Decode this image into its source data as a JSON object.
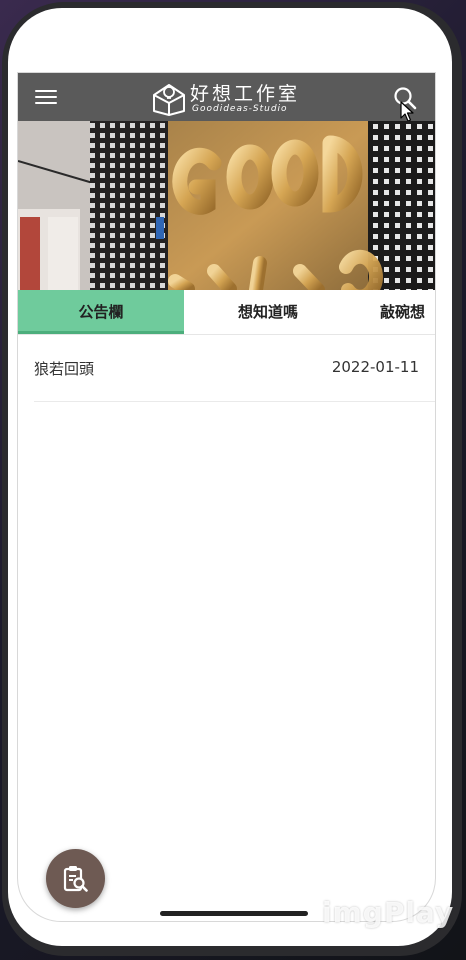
{
  "header": {
    "brand_name": "好想工作室",
    "brand_subtitle": "Goodideas-Studio",
    "menu_icon": "hamburger-menu-icon",
    "search_icon": "search-icon",
    "background_color": "#5a5a5a"
  },
  "banner": {
    "image": "gold-letter-balloons-photo",
    "balloon_letters": "GOOD IDEAS"
  },
  "tabs": [
    {
      "label": "公告欄",
      "active": true
    },
    {
      "label": "想知道嗎",
      "active": false
    },
    {
      "label": "敲碗想",
      "active": false
    }
  ],
  "tab_active_color": "#6fcb9c",
  "announcements": [
    {
      "title": "狼若回頭",
      "date": "2022-01-11"
    }
  ],
  "fab": {
    "icon": "clipboard-search-icon",
    "color": "#6e5a53"
  },
  "watermark": "imgPlay"
}
